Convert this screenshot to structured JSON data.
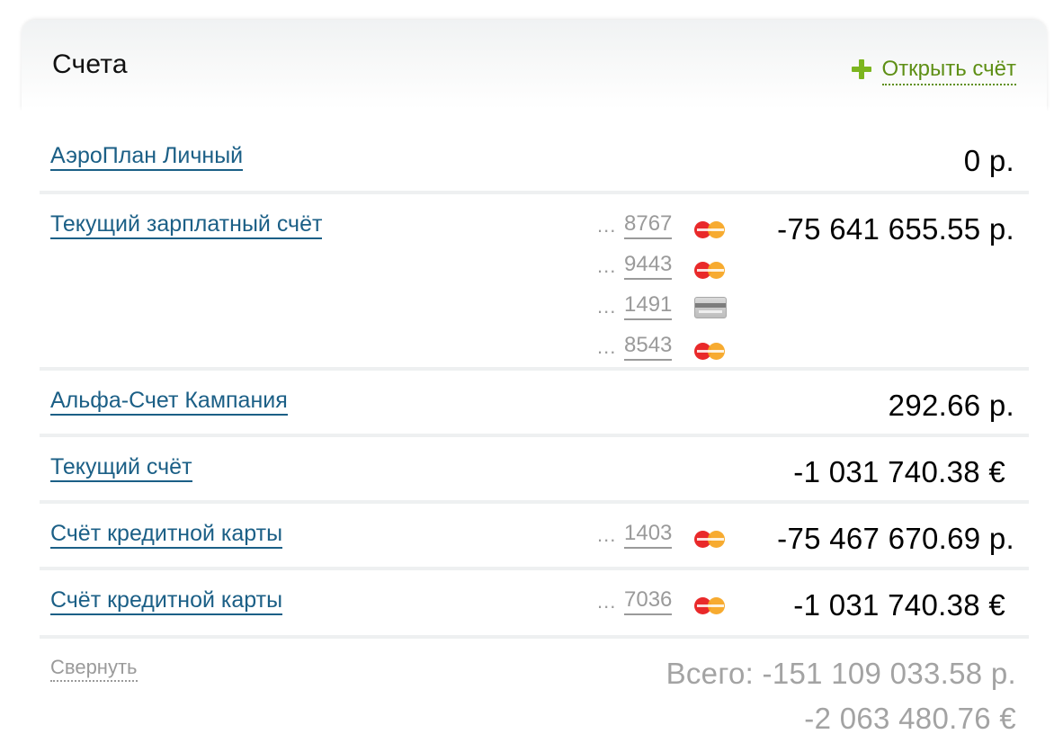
{
  "header": {
    "title": "Счета",
    "open_account_label": "Открыть счёт",
    "open_account_icon": "plus-icon",
    "accent_color": "#7cb51f"
  },
  "accounts": [
    {
      "name": "АэроПлан Личный",
      "amount": "0 р."
    },
    {
      "name": "Текущий зарплатный счёт",
      "amount": "-75 641 655.55 р.",
      "cards": [
        {
          "prefix": "...",
          "number": "8767",
          "icon": "mastercard-icon"
        },
        {
          "prefix": "...",
          "number": "9443",
          "icon": "mastercard-icon"
        },
        {
          "prefix": "...",
          "number": "1491",
          "icon": "generic-card-icon"
        },
        {
          "prefix": "...",
          "number": "8543",
          "icon": "mastercard-icon"
        }
      ]
    },
    {
      "name": "Альфа-Счет Кампания",
      "amount": "292.66 р."
    },
    {
      "name": "Текущий счёт",
      "amount": "-1 031 740.38 €"
    },
    {
      "name": "Счёт кредитной карты",
      "amount": "-75 467 670.69 р.",
      "cards": [
        {
          "prefix": "...",
          "number": "1403",
          "icon": "mastercard-icon"
        }
      ]
    },
    {
      "name": "Счёт кредитной карты",
      "amount": "-1 031 740.38 €",
      "cards": [
        {
          "prefix": "...",
          "number": "7036",
          "icon": "mastercard-icon"
        }
      ]
    }
  ],
  "footer": {
    "collapse_label": "Свернуть",
    "total_rub": "Всего: -151 109 033.58 р.",
    "total_eur": "-2 063 480.76 €"
  },
  "colors": {
    "link": "#1b5f86",
    "muted": "#9a9a9a",
    "row_divider": "#eef0f1"
  }
}
